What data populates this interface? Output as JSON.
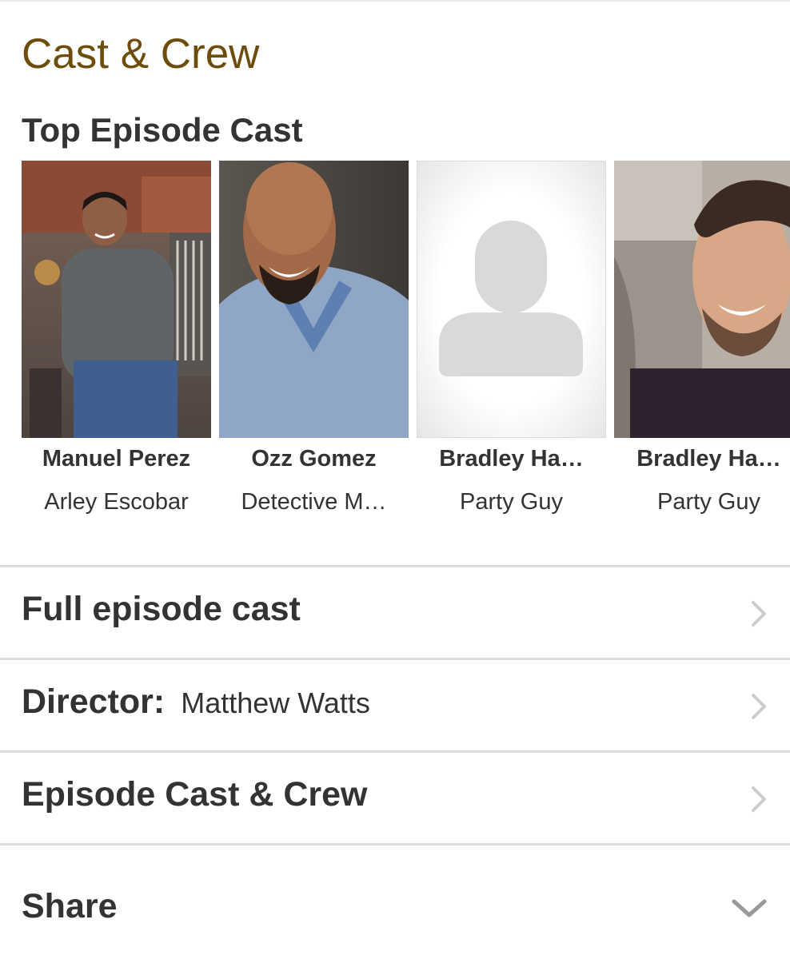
{
  "header": {
    "title": "Cast & Crew",
    "subtitle": "Top Episode Cast"
  },
  "cast": [
    {
      "name": "Manuel Perez",
      "role": "Arley Escobar",
      "photo": "photo"
    },
    {
      "name": "Ozz Gomez",
      "role": "Detective M…",
      "photo": "photo"
    },
    {
      "name": "Bradley Ha…",
      "role": "Party Guy",
      "photo": "placeholder-silhouette"
    },
    {
      "name": "Bradley Ha…",
      "role": "Party Guy",
      "photo": "photo"
    }
  ],
  "menu": {
    "full_cast": {
      "label": "Full episode cast",
      "icon": "chevron-right-icon"
    },
    "director": {
      "label": "Director:",
      "value": "Matthew Watts",
      "icon": "chevron-right-icon"
    },
    "episode_cast_crew": {
      "label": "Episode Cast & Crew",
      "icon": "chevron-right-icon"
    },
    "share": {
      "label": "Share",
      "icon": "chevron-down-icon"
    }
  },
  "colors": {
    "section_title": "#6e4d0b",
    "text": "#333333",
    "divider": "#dddddd",
    "chevron": "#cccccc"
  }
}
